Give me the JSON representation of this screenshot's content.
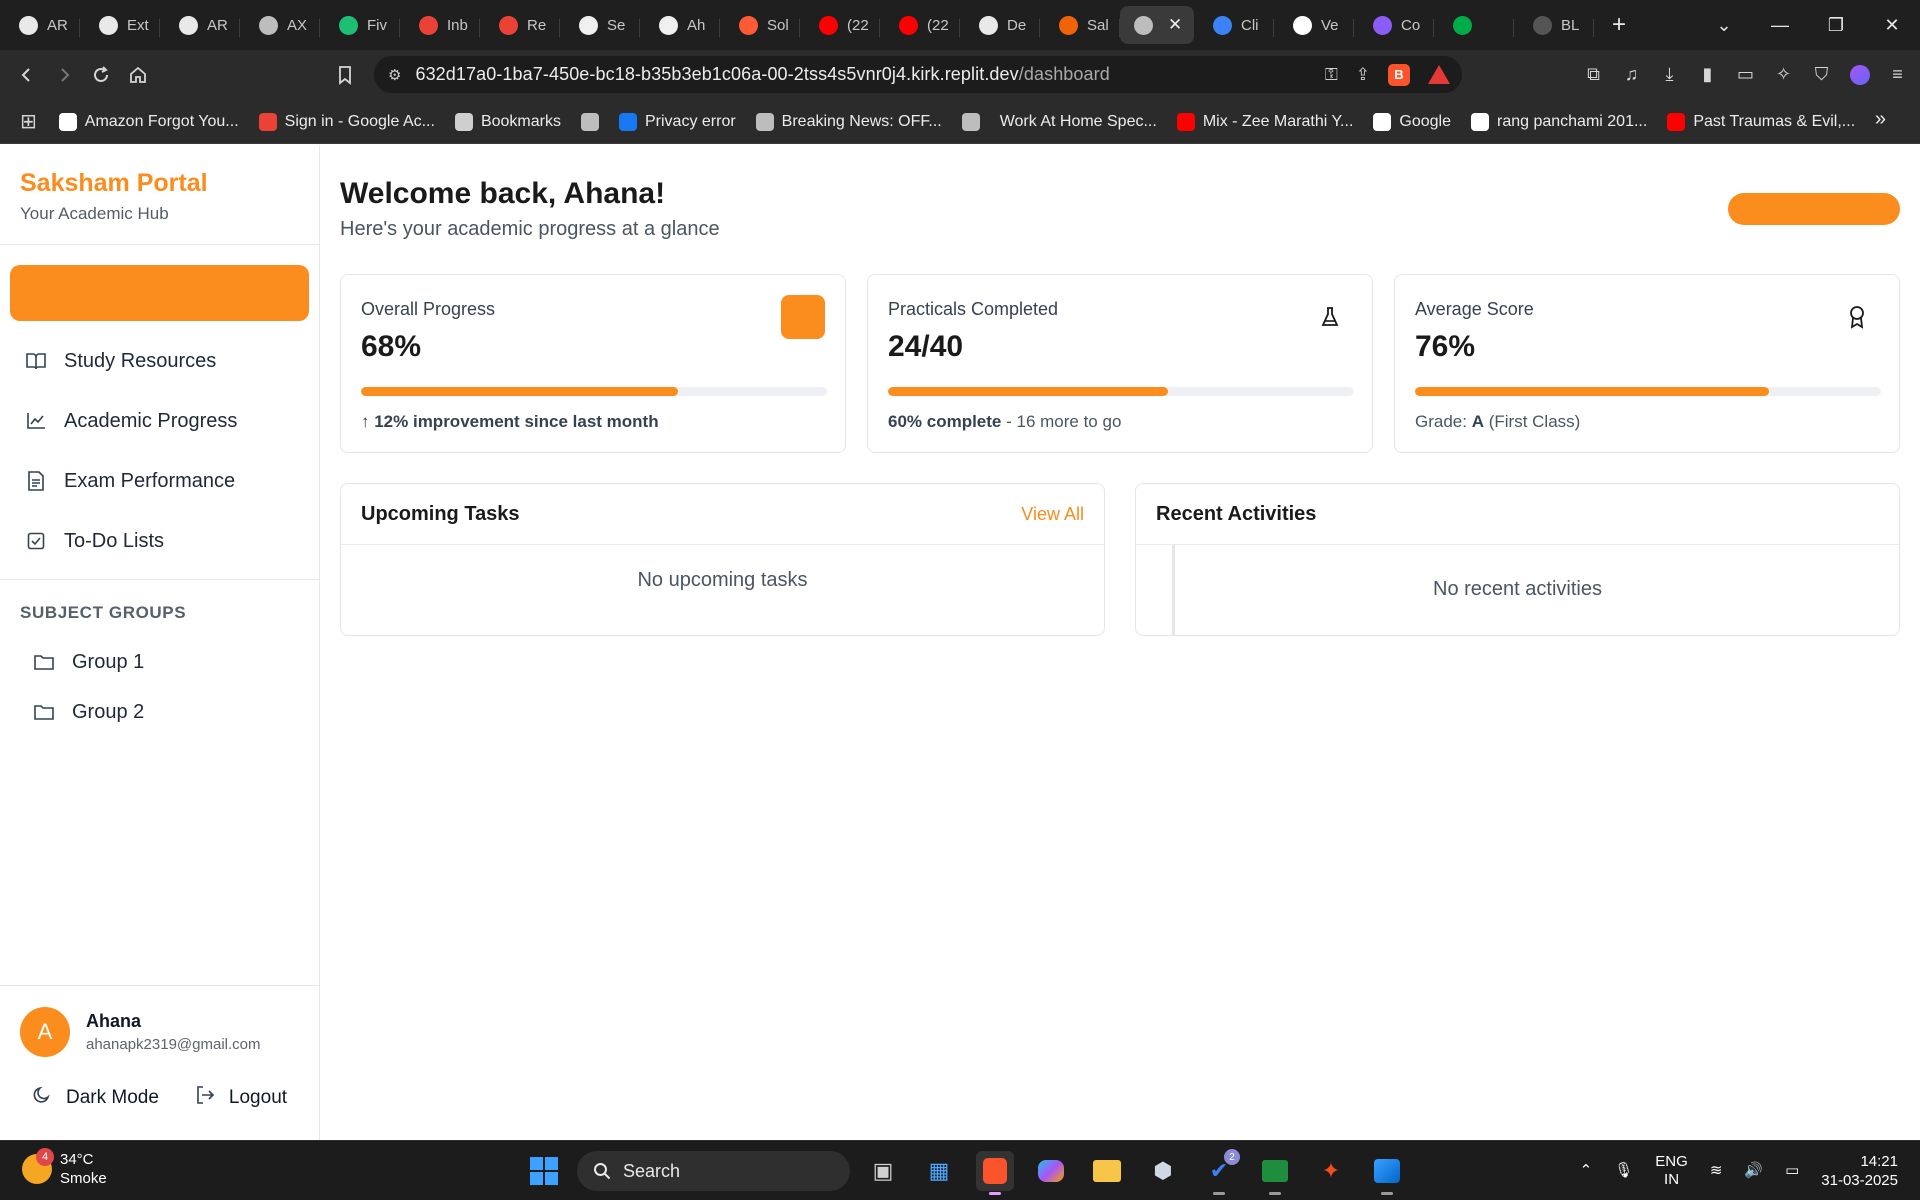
{
  "browser": {
    "tabs": [
      {
        "title": "AR",
        "icon": "openai-icon",
        "color": "#e9e9e9"
      },
      {
        "title": "Ext",
        "icon": "openai-icon",
        "color": "#e9e9e9"
      },
      {
        "title": "AR",
        "icon": "openai-icon",
        "color": "#e9e9e9"
      },
      {
        "title": "AX",
        "icon": "globe-icon",
        "color": "#bdbdbd"
      },
      {
        "title": "Fiv",
        "icon": "fiverr-icon",
        "color": "#1dbf73"
      },
      {
        "title": "Inb",
        "icon": "gmail-icon",
        "color": "#ea4335"
      },
      {
        "title": "Re",
        "icon": "gmail-icon",
        "color": "#ea4335"
      },
      {
        "title": "Se",
        "icon": "github-icon",
        "color": "#f0f0f0"
      },
      {
        "title": "Ah",
        "icon": "github-icon",
        "color": "#f0f0f0"
      },
      {
        "title": "Sol",
        "icon": "bolt-icon",
        "color": "#ff5a36"
      },
      {
        "title": "(22",
        "icon": "youtube-icon",
        "color": "#ff0000"
      },
      {
        "title": "(22",
        "icon": "youtube-icon",
        "color": "#ff0000"
      },
      {
        "title": "De",
        "icon": "discord-icon",
        "color": "#e9e9e9"
      },
      {
        "title": "Sal",
        "icon": "replit-icon",
        "color": "#f26207"
      },
      {
        "title": "",
        "icon": "globe-icon",
        "color": "#bdbdbd",
        "active": true
      },
      {
        "title": "Cli",
        "icon": "shield-icon",
        "color": "#3b82f6"
      },
      {
        "title": "Ve",
        "icon": "vercel-icon",
        "color": "#ffffff"
      },
      {
        "title": "Co",
        "icon": "u-icon",
        "color": "#8b5cf6"
      },
      {
        "title": "",
        "icon": "meet-icon",
        "color": "#00ac47"
      },
      {
        "title": "BL",
        "icon": "perplexity-icon",
        "color": "#555555"
      }
    ],
    "url_host": "632d17a0-1ba7-450e-bc18-b35b3eb1c06a-00-2tss4s5vnr0j4.kirk.replit.dev",
    "url_path": "/dashboard",
    "bookmarks": [
      {
        "label": "Amazon Forgot You...",
        "icon": "amazon-icon",
        "color": "#ffffff"
      },
      {
        "label": "Sign in - Google Ac...",
        "icon": "gmail-icon",
        "color": "#ea4335"
      },
      {
        "label": "Bookmarks",
        "icon": "bookmark-folder-icon",
        "color": "#cfcfcf"
      },
      {
        "label": "",
        "icon": "globe-icon",
        "color": "#bdbdbd"
      },
      {
        "label": "Privacy error",
        "icon": "facebook-icon",
        "color": "#1877f2"
      },
      {
        "label": "Breaking News: OFF...",
        "icon": "globe-icon",
        "color": "#bdbdbd"
      },
      {
        "label": "",
        "icon": "globe-icon",
        "color": "#bdbdbd"
      },
      {
        "label": "Work At Home Spec...",
        "icon": "none",
        "color": "#2b2b2b"
      },
      {
        "label": "Mix - Zee Marathi Y...",
        "icon": "youtube-icon",
        "color": "#ff0000"
      },
      {
        "label": "Google",
        "icon": "google-icon",
        "color": "#ffffff"
      },
      {
        "label": "rang panchami 201...",
        "icon": "google-icon",
        "color": "#ffffff"
      },
      {
        "label": "Past Traumas & Evil,...",
        "icon": "youtube-icon",
        "color": "#ff0000"
      }
    ]
  },
  "sidebar": {
    "brand": "Saksham Portal",
    "tagline": "Your Academic Hub",
    "nav": [
      {
        "label": "Study Resources",
        "icon": "book-open-icon"
      },
      {
        "label": "Academic Progress",
        "icon": "line-chart-icon"
      },
      {
        "label": "Exam Performance",
        "icon": "file-text-icon"
      },
      {
        "label": "To-Do Lists",
        "icon": "check-square-icon"
      }
    ],
    "groups_heading": "SUBJECT GROUPS",
    "groups": [
      {
        "label": "Group 1",
        "icon": "folder-icon"
      },
      {
        "label": "Group 2",
        "icon": "folder-icon"
      }
    ],
    "user": {
      "initial": "A",
      "name": "Ahana",
      "email": "ahanapk2319@gmail.com"
    },
    "dark_mode_label": "Dark Mode",
    "logout_label": "Logout"
  },
  "main": {
    "welcome": "Welcome back, Ahana!",
    "subtitle": "Here's your academic progress at a glance",
    "stats": [
      {
        "label": "Overall Progress",
        "value": "68%",
        "progress": 0.68,
        "icon": "orange-square-icon",
        "foot_strong": "↑ 12% improvement since last month",
        "foot_rest": ""
      },
      {
        "label": "Practicals Completed",
        "value": "24/40",
        "progress": 0.6,
        "icon": "flask-icon",
        "foot_strong": "60% complete",
        "foot_rest": " - 16 more to go"
      },
      {
        "label": "Average Score",
        "value": "76%",
        "progress": 0.76,
        "icon": "award-icon",
        "foot_pre": "Grade: ",
        "foot_strong": "A",
        "foot_rest": " (First Class)"
      }
    ],
    "tasks": {
      "title": "Upcoming Tasks",
      "view_all": "View All",
      "empty": "No upcoming tasks"
    },
    "activities": {
      "title": "Recent Activities",
      "empty": "No recent activities"
    }
  },
  "taskbar": {
    "weather_badge": "4",
    "temperature": "34°C",
    "condition": "Smoke",
    "search_label": "Search",
    "lang_top": "ENG",
    "lang_bottom": "IN",
    "time": "14:21",
    "date": "31-03-2025",
    "todo_badge": "2"
  },
  "colors": {
    "accent": "#fb8c1e",
    "text": "#1a1a1a",
    "muted": "#4b5563",
    "border": "#e4e6ea"
  }
}
